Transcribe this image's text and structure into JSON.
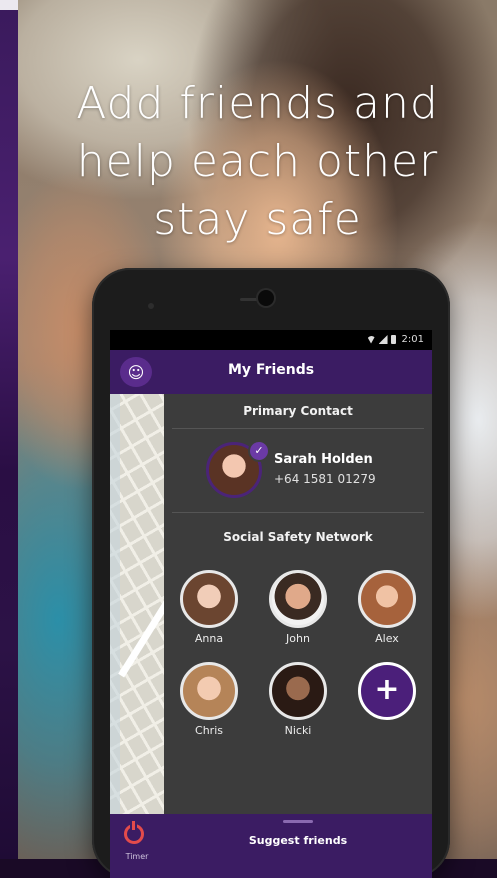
{
  "headline": [
    "Add friends and",
    "help each other",
    "stay safe"
  ],
  "status_bar": {
    "time": "2:01"
  },
  "app_bar": {
    "title": "My Friends",
    "logo_icon": "app-logo-icon"
  },
  "primary_contact": {
    "section_title": "Primary Contact",
    "name": "Sarah Holden",
    "phone": "+64 1581 01279"
  },
  "network": {
    "section_title": "Social Safety Network",
    "friends": [
      {
        "name": "Anna"
      },
      {
        "name": "John"
      },
      {
        "name": "Alex"
      },
      {
        "name": "Chris"
      },
      {
        "name": "Nicki"
      }
    ]
  },
  "bottom_nav": {
    "label": "Timer"
  },
  "suggest": {
    "label": "Suggest friends"
  },
  "colors": {
    "brand_purple": "#3b1c63",
    "accent_red": "#e34b4b"
  }
}
